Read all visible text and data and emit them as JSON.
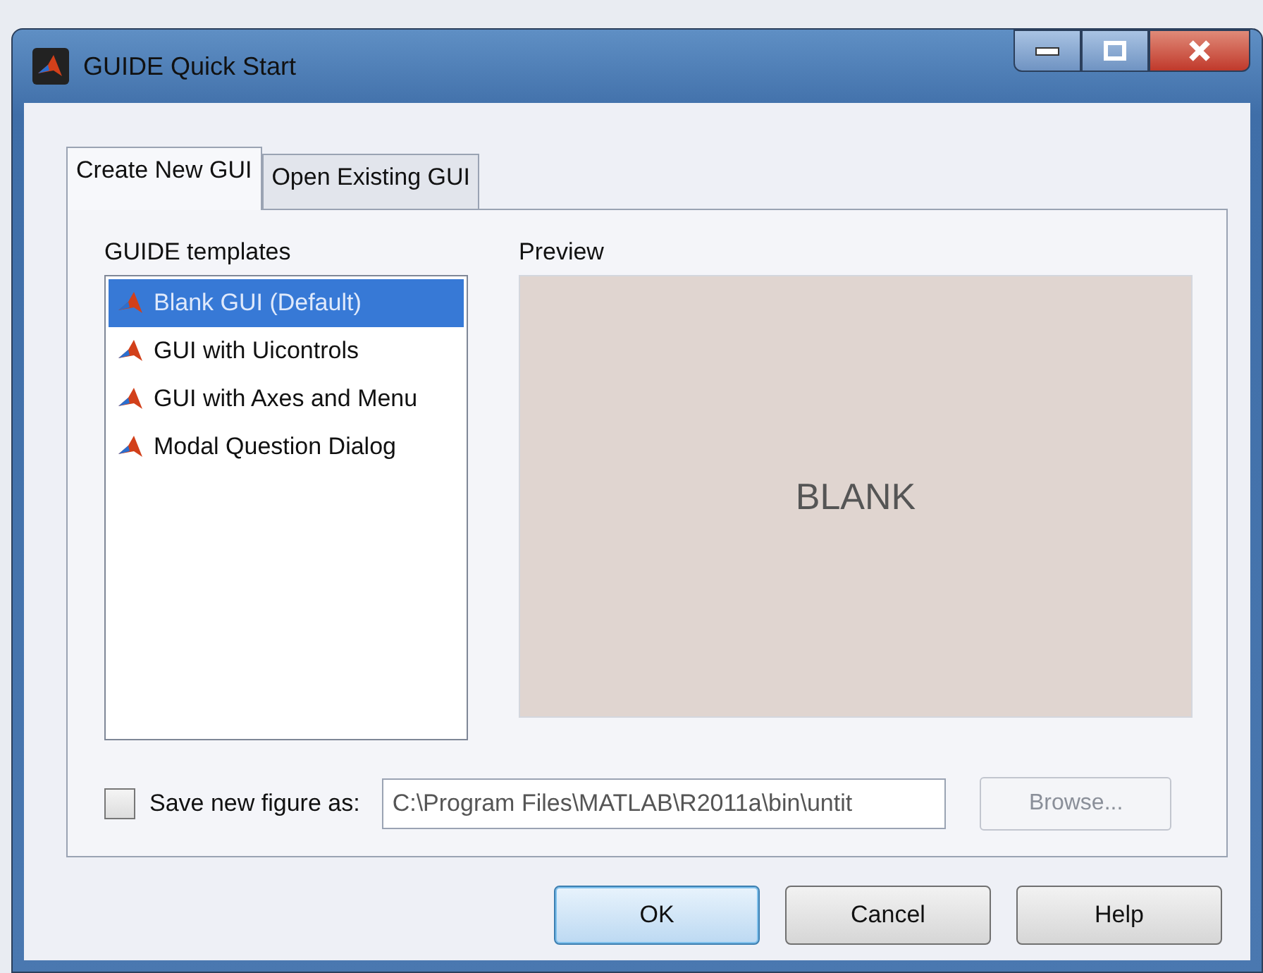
{
  "window": {
    "title": "GUIDE Quick Start"
  },
  "tabs": [
    {
      "label": "Create New GUI",
      "selected": true
    },
    {
      "label": "Open Existing GUI",
      "selected": false
    }
  ],
  "templates": {
    "label": "GUIDE templates",
    "items": [
      {
        "label": "Blank GUI (Default)",
        "selected": true
      },
      {
        "label": "GUI with Uicontrols",
        "selected": false
      },
      {
        "label": "GUI with Axes and Menu",
        "selected": false
      },
      {
        "label": "Modal Question Dialog",
        "selected": false
      }
    ]
  },
  "preview": {
    "label": "Preview",
    "text": "BLANK"
  },
  "save": {
    "label": "Save new figure as:",
    "checked": false,
    "value": "C:\\Program Files\\MATLAB\\R2011a\\bin\\untit"
  },
  "browse": {
    "label": "Browse...",
    "disabled": true
  },
  "buttons": [
    {
      "label": "OK",
      "default": true
    },
    {
      "label": "Cancel",
      "default": false
    },
    {
      "label": "Help",
      "default": false
    }
  ]
}
